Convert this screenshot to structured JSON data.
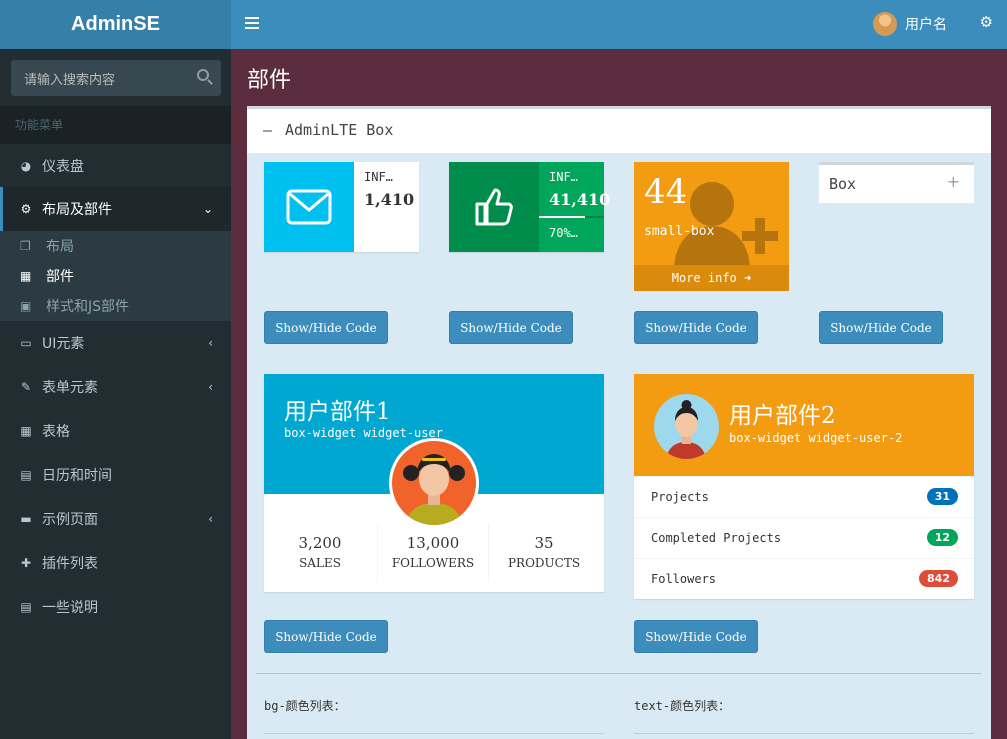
{
  "header": {
    "logo": "AdminSE",
    "username": "用户名"
  },
  "sidebar": {
    "search_placeholder": "请输入搜索内容",
    "section_label": "功能菜单",
    "items": [
      {
        "label": "仪表盘",
        "icon": "dashboard-icon"
      },
      {
        "label": "布局及部件",
        "icon": "cogs-icon",
        "expanded": true
      },
      {
        "label": "UI元素",
        "icon": "laptop-icon"
      },
      {
        "label": "表单元素",
        "icon": "edit-icon"
      },
      {
        "label": "表格",
        "icon": "table-icon"
      },
      {
        "label": "日历和时间",
        "icon": "calendar-icon"
      },
      {
        "label": "示例页面",
        "icon": "folder-icon"
      },
      {
        "label": "插件列表",
        "icon": "plus-icon"
      },
      {
        "label": "一些说明",
        "icon": "file-icon"
      }
    ],
    "submenu": [
      {
        "label": "布局",
        "icon": "copy-icon"
      },
      {
        "label": "部件",
        "icon": "th-icon",
        "current": true
      },
      {
        "label": "样式和JS部件",
        "icon": "briefcase-icon"
      }
    ]
  },
  "page": {
    "title": "部件",
    "box_title": "AdminLTE Box"
  },
  "widgets": {
    "infobox1": {
      "text": "INF…",
      "number": "1,410",
      "color": "#00c0ef",
      "icon": "envelope-icon"
    },
    "infobox2": {
      "text": "INF…",
      "number": "41,410",
      "progress_text": "70%…",
      "progress": 0.7,
      "color": "#00a65a",
      "icon": "thumbs-up-icon"
    },
    "smallbox": {
      "number": "44",
      "text": "small-box",
      "footer": "More info",
      "color": "#f39c12",
      "icon": "user-plus-icon"
    },
    "minibox": {
      "title": "Box"
    },
    "code_button": "Show/Hide Code",
    "user1": {
      "name": "用户部件1",
      "desc": "box-widget widget-user",
      "stats": [
        {
          "value": "3,200",
          "label": "SALES"
        },
        {
          "value": "13,000",
          "label": "FOLLOWERS"
        },
        {
          "value": "35",
          "label": "PRODUCTS"
        }
      ]
    },
    "user2": {
      "name": "用户部件2",
      "desc": "box-widget widget-user-2",
      "rows": [
        {
          "label": "Projects",
          "badge": "31",
          "color": "#0073b7"
        },
        {
          "label": "Completed Projects",
          "badge": "12",
          "color": "#00a65a"
        },
        {
          "label": "Followers",
          "badge": "842",
          "color": "#dd4b39"
        }
      ]
    }
  },
  "colors": {
    "bg_label": "bg-颜色列表：",
    "text_label": "text-颜色列表："
  }
}
